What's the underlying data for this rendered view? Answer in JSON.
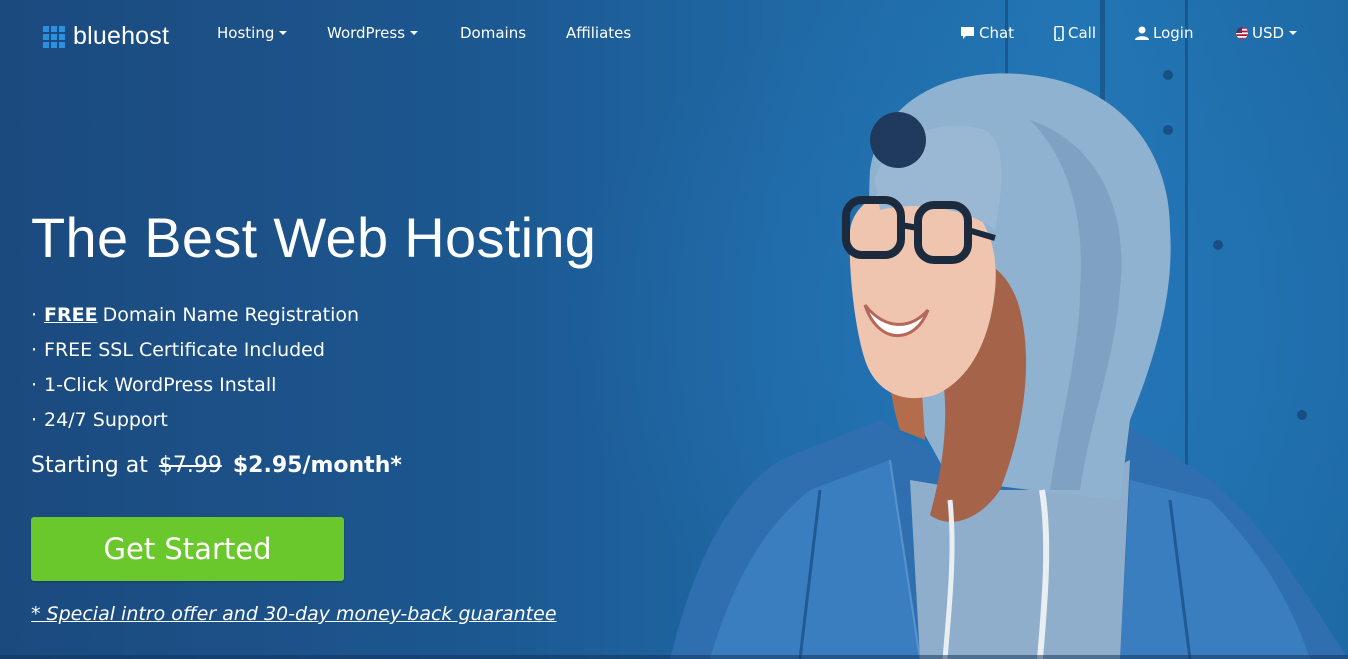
{
  "brand": {
    "name": "bluehost",
    "accent_color": "#2b90e0"
  },
  "nav": {
    "hosting": "Hosting",
    "wordpress": "WordPress",
    "domains": "Domains",
    "affiliates": "Affiliates",
    "chat": "Chat",
    "call": "Call",
    "login": "Login",
    "currency": "USD"
  },
  "hero": {
    "headline": "The Best Web Hosting",
    "features": [
      {
        "bullet": "·",
        "emphasis": "FREE",
        "text": "Domain Name Registration"
      },
      {
        "bullet": "·",
        "text": "FREE SSL Certificate Included"
      },
      {
        "bullet": "·",
        "text": "1-Click WordPress Install"
      },
      {
        "bullet": "·",
        "text": "24/7 Support"
      }
    ],
    "price": {
      "prefix": "Starting at",
      "old_price": "$7.99",
      "new_price": "$2.95/month*"
    },
    "cta_label": "Get Started",
    "cta_color": "#6ac72c",
    "offer_link": "* Special intro offer and 30-day money-back guarantee"
  },
  "icons": {
    "chat": "chat-bubble-icon",
    "call": "phone-icon",
    "login": "user-icon",
    "currency": "us-flag-icon"
  }
}
